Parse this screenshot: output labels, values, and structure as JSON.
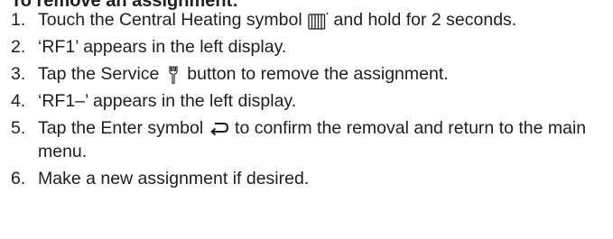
{
  "heading": "To remove an assignment:",
  "steps": [
    {
      "number": "1.",
      "text_before": "Touch the Central Heating symbol",
      "icon": "central-heating-icon",
      "text_after": "and hold for 2 seconds."
    },
    {
      "number": "2.",
      "text_before": "‘RF1’ appears in the left display.",
      "icon": "",
      "text_after": ""
    },
    {
      "number": "3.",
      "text_before": "Tap the Service",
      "icon": "service-icon",
      "text_after": "button to remove the assignment."
    },
    {
      "number": "4.",
      "text_before": "‘RF1–’ appears in the left display.",
      "icon": "",
      "text_after": ""
    },
    {
      "number": "5.",
      "text_before": "Tap the Enter symbol",
      "icon": "enter-icon",
      "text_after": "to confirm the removal and return to the main menu."
    },
    {
      "number": "6.",
      "text_before": "Make a new assignment if desired.",
      "icon": "",
      "text_after": ""
    }
  ]
}
